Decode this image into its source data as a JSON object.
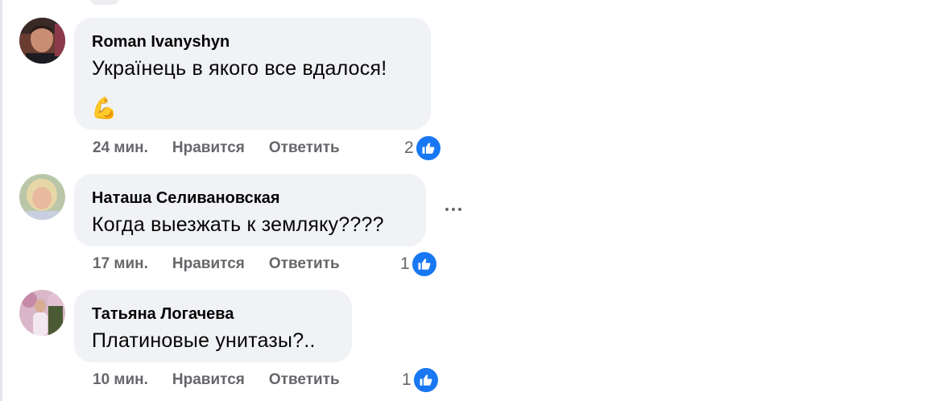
{
  "comments": [
    {
      "author": "Roman Ivanyshyn",
      "text": "Українець в якого все вдалося!",
      "emoji": "💪",
      "time": "24 мин.",
      "like_label": "Нравится",
      "reply_label": "Ответить",
      "reaction_count": "2",
      "reaction_icon": "thumbs-up-icon"
    },
    {
      "author": "Наташа Селивановская",
      "text": "Когда выезжать к земляку????",
      "time": "17 мин.",
      "like_label": "Нравится",
      "reply_label": "Ответить",
      "reaction_count": "1",
      "reaction_icon": "thumbs-up-icon"
    },
    {
      "author": "Татьяна Логачева",
      "text": "Платиновые унитазы?..",
      "time": "10 мин.",
      "like_label": "Нравится",
      "reply_label": "Ответить",
      "reaction_count": "1",
      "reaction_icon": "thumbs-up-icon"
    }
  ],
  "colors": {
    "bubble": "#f0f2f5",
    "secondary_text": "#65676b",
    "like_blue": "#1877f2"
  },
  "more_menu_icon": "more-options-icon"
}
